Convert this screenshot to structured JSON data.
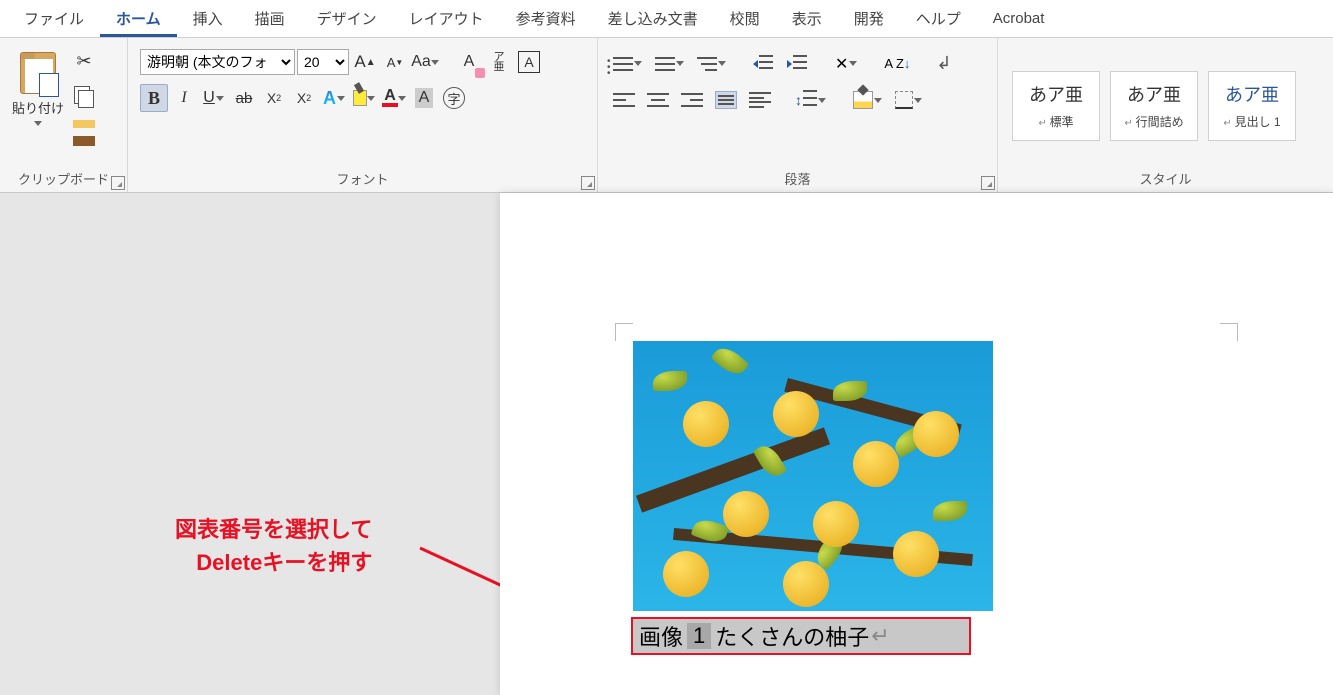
{
  "menu": {
    "file": "ファイル",
    "home": "ホーム",
    "insert": "挿入",
    "draw": "描画",
    "design": "デザイン",
    "layout": "レイアウト",
    "references": "参考資料",
    "mailings": "差し込み文書",
    "review": "校閲",
    "view": "表示",
    "developer": "開発",
    "help": "ヘルプ",
    "acrobat": "Acrobat"
  },
  "ribbon": {
    "clipboard": {
      "label": "クリップボード",
      "paste": "貼り付け"
    },
    "font": {
      "label": "フォント",
      "name": "游明朝 (本文のフォ",
      "size": "20",
      "grow": "A",
      "shrink": "A",
      "case": "Aa",
      "clear": "A",
      "ruby_top": "ア",
      "ruby_bot": "亜",
      "boxed": "A",
      "bold": "B",
      "italic": "I",
      "under": "U",
      "strike": "ab",
      "sub": "X",
      "sup": "X",
      "effect": "A",
      "color": "A",
      "charshade": "A",
      "circled": "字"
    },
    "paragraph": {
      "label": "段落",
      "sort": "A\nZ",
      "marks": "↲"
    },
    "styles": {
      "label": "スタイル",
      "items": [
        {
          "preview": "あア亜",
          "name": "標準"
        },
        {
          "preview": "あア亜",
          "name": "行間詰め"
        },
        {
          "preview": "あア亜",
          "name": "見出し 1"
        }
      ]
    }
  },
  "document": {
    "caption_label": "画像",
    "caption_number": "1",
    "caption_text": "たくさんの柚子",
    "image_alt": "柚子の木の写真"
  },
  "annotation": {
    "line1": "図表番号を選択して",
    "line2": "Deleteキーを押す"
  }
}
